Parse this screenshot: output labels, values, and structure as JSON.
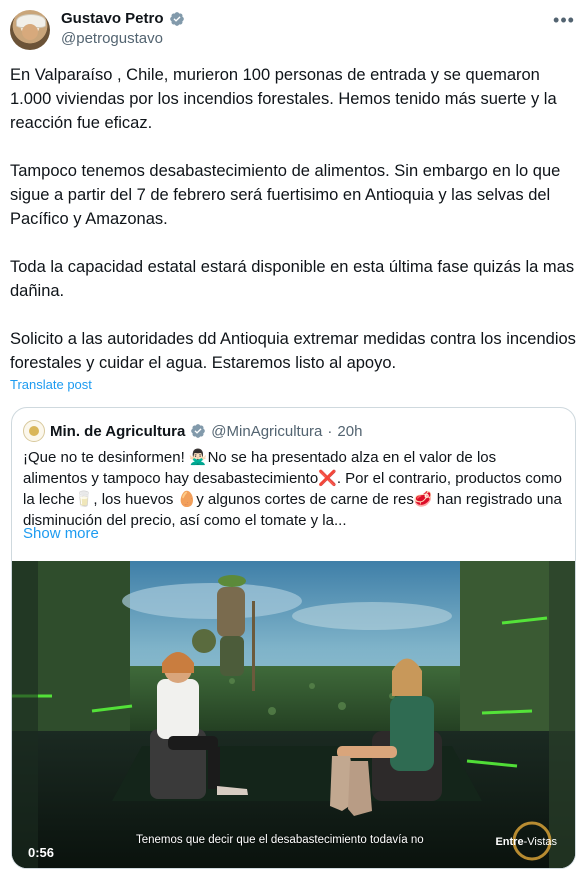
{
  "author": {
    "name": "Gustavo Petro",
    "handle": "@petrogustavo",
    "verified": true
  },
  "more_icon": "more-horizontal-icon",
  "tweet": {
    "paragraphs": [
      "En Valparaíso , Chile, murieron 100 personas de entrada y se quemaron 1.000 viviendas por los incendios forestales. Hemos tenido más suerte y la reacción fue eficaz.",
      "Tampoco tenemos desabastecimiento de alimentos. Sin embargo en lo que sigue a partir del 7 de febrero será fuertisimo en Antioquia y las selvas del Pacífico y Amazonas.",
      "Toda la capacidad estatal estará disponible en esta última fase quizás la mas dañina.",
      "Solicito a las autoridades dd Antioquia extremar medidas contra los incendios forestales y cuidar el agua. Estaremos listo al apoyo."
    ],
    "translate_label": "Translate post"
  },
  "quote": {
    "name": "Min. de Agricultura",
    "handle": "@MinAgricultura",
    "separator": "·",
    "time": "20h",
    "text": "¡Que no te desinformen! 🙅🏻‍♂️No se ha presentado alza en el valor de los alimentos y tampoco hay desabastecimiento❌. Por el contrario, productos como la leche🥛, los huevos 🥚y algunos cortes de carne de res🥩 han registrado una disminución del precio, así como el tomate y la...",
    "show_more": "Show more",
    "video": {
      "duration": "0:56",
      "caption": "Tenemos que decir que el desabastecimiento todavía no",
      "brand_bold": "Entre",
      "brand_rest": "-Vistas"
    }
  },
  "colors": {
    "link": "#1d9bf0",
    "secondary_text": "#536471",
    "verified_blue": "#1d9bf0",
    "verified_gray": "#829aab"
  }
}
